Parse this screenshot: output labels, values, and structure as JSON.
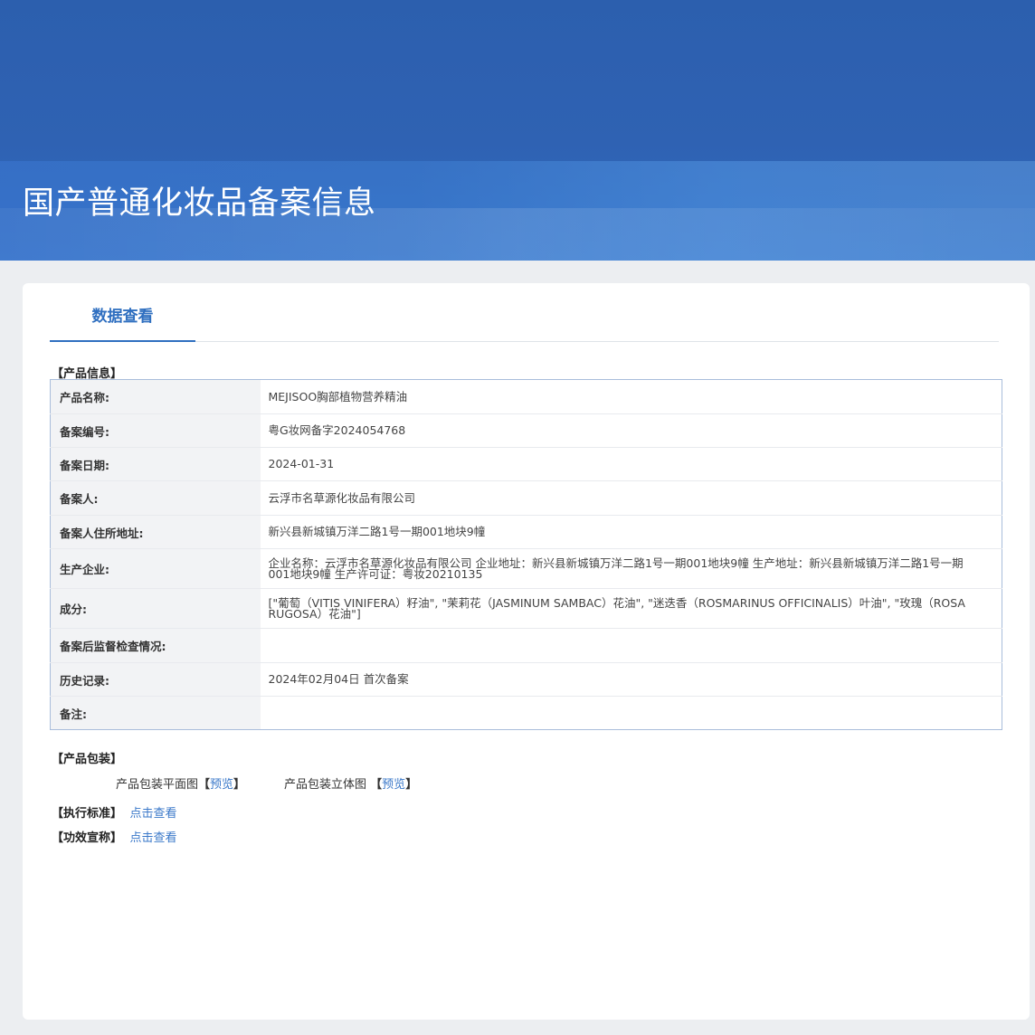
{
  "banner": {
    "title": "国产普通化妆品备案信息"
  },
  "tabs": [
    {
      "label": "数据查看"
    }
  ],
  "product_info": {
    "section_title": "【产品信息】",
    "rows": [
      {
        "label": "产品名称:",
        "value": "MEJISOO胸部植物营养精油"
      },
      {
        "label": "备案编号:",
        "value": "粤G妆网备字2024054768"
      },
      {
        "label": "备案日期:",
        "value": "2024-01-31"
      },
      {
        "label": "备案人:",
        "value": "云浮市名草源化妆品有限公司"
      },
      {
        "label": "备案人住所地址:",
        "value": "新兴县新城镇万洋二路1号一期001地块9幢"
      },
      {
        "label": "生产企业:",
        "value": "企业名称：云浮市名草源化妆品有限公司 企业地址：新兴县新城镇万洋二路1号一期001地块9幢 生产地址：新兴县新城镇万洋二路1号一期001地块9幢 生产许可证：粤妆20210135"
      },
      {
        "label": "成分:",
        "value": "[\"葡萄（VITIS VINIFERA）籽油\", \"茉莉花（JASMINUM SAMBAC）花油\", \"迷迭香（ROSMARINUS OFFICINALIS）叶油\", \"玫瑰（ROSA RUGOSA）花油\"]"
      },
      {
        "label": "备案后监督检查情况:",
        "value": ""
      },
      {
        "label": "历史记录:",
        "value": "2024年02月04日 首次备案"
      },
      {
        "label": "备注:",
        "value": ""
      }
    ]
  },
  "packaging": {
    "section_title": "【产品包装】",
    "flat_label": "产品包装平面图",
    "flat_link": "预览",
    "solid_label": "产品包装立体图",
    "solid_link": "预览",
    "bracket_open": "【",
    "bracket_close": "】"
  },
  "standard": {
    "label": "【执行标准】",
    "link": "点击查看"
  },
  "efficacy": {
    "label": "【功效宣称】",
    "link": "点击查看"
  }
}
